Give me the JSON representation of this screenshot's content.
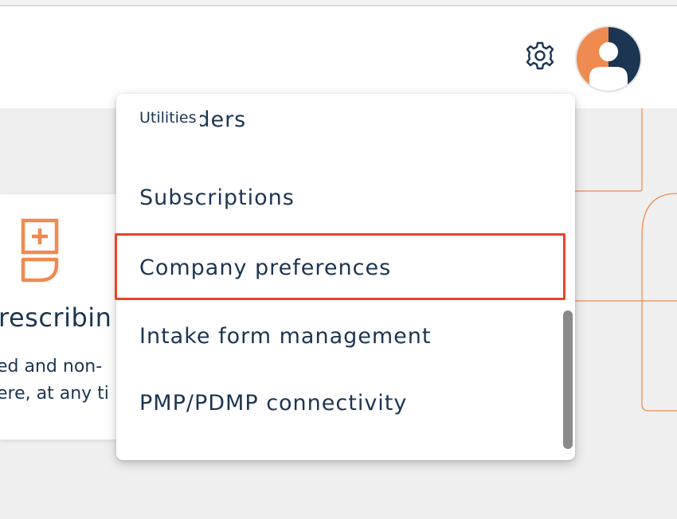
{
  "header": {
    "settings_icon": "gear-icon",
    "avatar_icon": "user-avatar-icon"
  },
  "colors": {
    "accent": "#ef8a50",
    "navy": "#1b3552",
    "highlight": "#e8432b",
    "scrollbar": "#8a8a8a"
  },
  "card": {
    "icon": "medical-cross-icon",
    "title": "rescribin",
    "desc_line1": "ed and non-",
    "desc_line2": "ere, at any ti"
  },
  "menu": {
    "section_header": "Utilities",
    "items": [
      {
        "label": "Providers"
      },
      {
        "label": "Subscriptions"
      },
      {
        "label": "Company preferences"
      },
      {
        "label": "Intake form management"
      },
      {
        "label": "PMP/PDMP connectivity"
      }
    ],
    "highlighted_item": "Company preferences"
  }
}
